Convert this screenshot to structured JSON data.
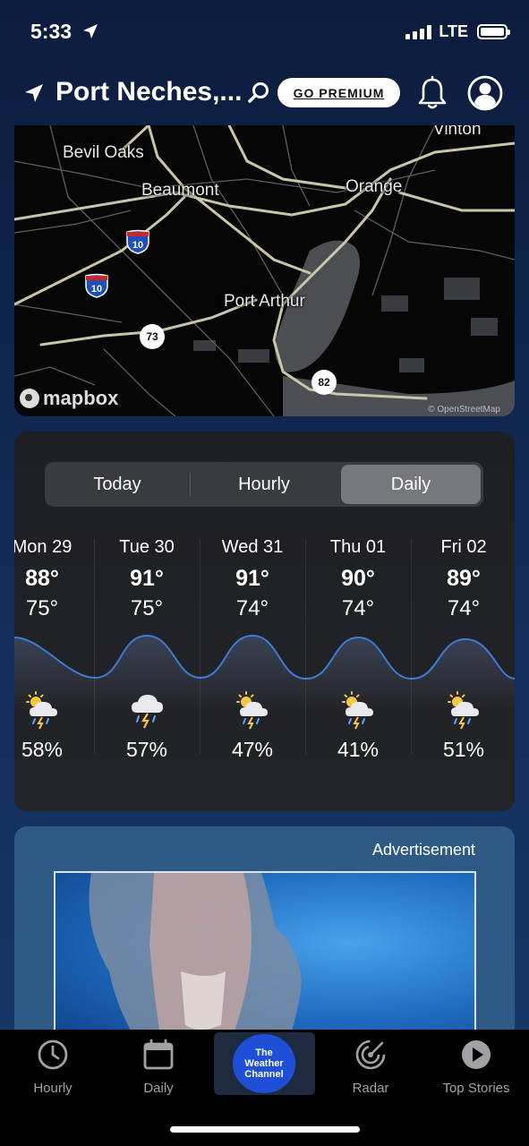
{
  "status": {
    "time": "5:33",
    "network": "LTE"
  },
  "header": {
    "location": "Port Neches,...",
    "premium_label": "GO PREMIUM"
  },
  "map": {
    "labels": {
      "vinton": "Vinton",
      "bevil_oaks": "Bevil Oaks",
      "beaumont": "Beaumont",
      "orange": "Orange",
      "port_arthur": "Port Arthur"
    },
    "routes": {
      "i10_a": "10",
      "i10_b": "10",
      "r73": "73",
      "r82": "82"
    },
    "logo": "mapbox",
    "credit": "© OpenStreetMap"
  },
  "forecast": {
    "tabs": [
      "Today",
      "Hourly",
      "Daily"
    ],
    "active_tab": "Daily",
    "days": [
      {
        "name": "Mon 29",
        "hi": "88°",
        "lo": "75°",
        "precip": "58%",
        "icon": "partly-cloudy-thunderstorm-icon"
      },
      {
        "name": "Tue 30",
        "hi": "91°",
        "lo": "75°",
        "precip": "57%",
        "icon": "thunderstorm-icon"
      },
      {
        "name": "Wed 31",
        "hi": "91°",
        "lo": "74°",
        "precip": "47%",
        "icon": "partly-cloudy-thunderstorm-icon"
      },
      {
        "name": "Thu 01",
        "hi": "90°",
        "lo": "74°",
        "precip": "41%",
        "icon": "partly-cloudy-thunderstorm-icon"
      },
      {
        "name": "Fri 02",
        "hi": "89°",
        "lo": "74°",
        "precip": "51%",
        "icon": "partly-cloudy-thunderstorm-icon"
      }
    ]
  },
  "ad": {
    "label": "Advertisement"
  },
  "tabbar": {
    "hourly": "Hourly",
    "daily": "Daily",
    "logo_lines": [
      "The",
      "Weather",
      "Channel"
    ],
    "radar": "Radar",
    "top_stories": "Top Stories"
  },
  "colors": {
    "accent_blue": "#3e7bd6",
    "active_segment": "#77787c",
    "background": "#112a55"
  }
}
